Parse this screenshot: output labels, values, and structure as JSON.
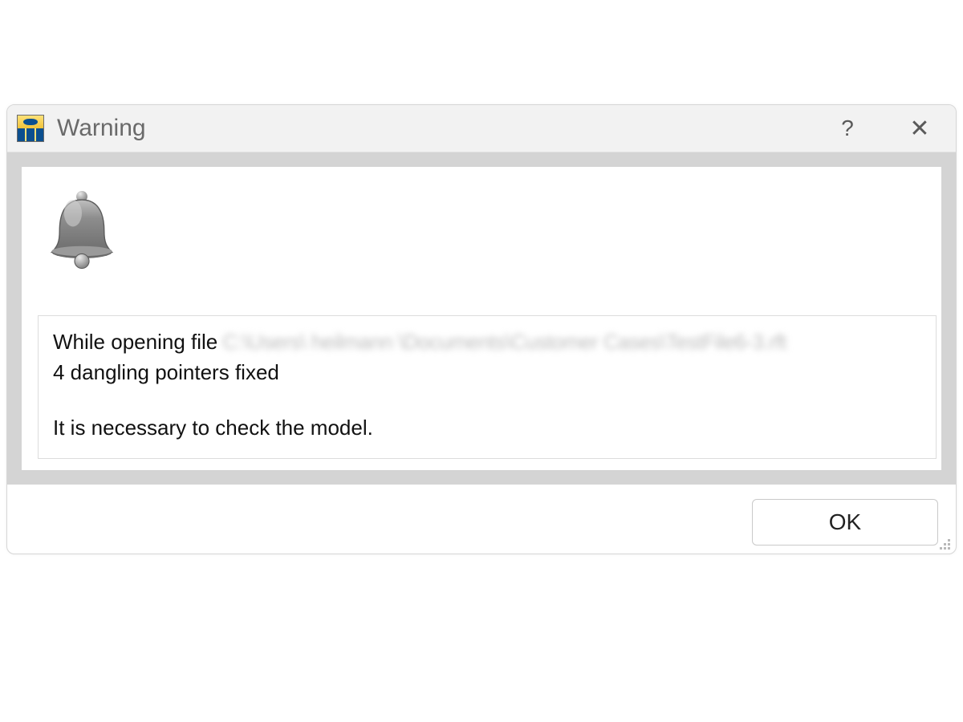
{
  "dialog": {
    "title": "Warning",
    "help_label": "?",
    "close_label": "✕",
    "message": {
      "line1_prefix": "While opening file",
      "line1_path_obscured": "C:\\Users\\ heilmann \\Documents\\Customer Cases\\TestFile6-3.rft",
      "line2": "4 dangling pointers fixed",
      "line3": "It is necessary to check the model."
    },
    "buttons": {
      "ok": "OK"
    }
  }
}
